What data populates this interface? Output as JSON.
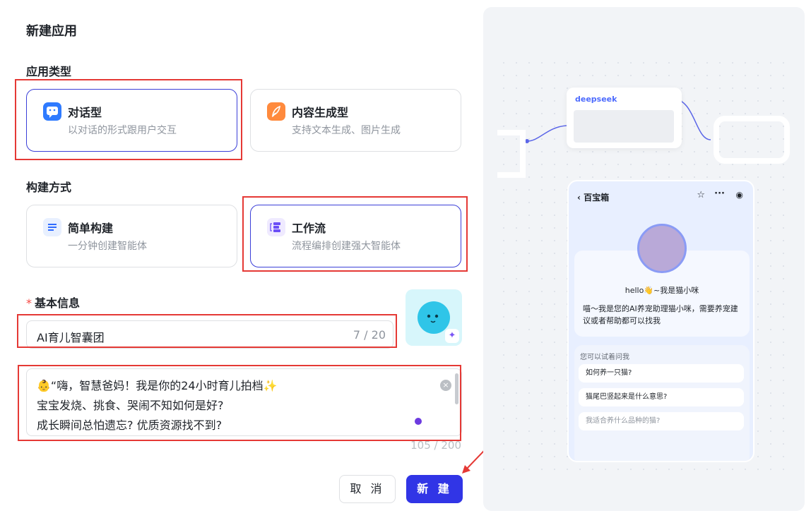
{
  "dialog": {
    "title": "新建应用"
  },
  "app_type": {
    "label": "应用类型",
    "options": [
      {
        "title": "对话型",
        "desc": "以对话的形式跟用户交互",
        "icon": "chat-icon",
        "selected": true
      },
      {
        "title": "内容生成型",
        "desc": "支持文本生成、图片生成",
        "icon": "feather-icon",
        "selected": false
      }
    ]
  },
  "build_mode": {
    "label": "构建方式",
    "options": [
      {
        "title": "简单构建",
        "desc": "一分钟创建智能体",
        "icon": "list-icon",
        "selected": false
      },
      {
        "title": "工作流",
        "desc": "流程编排创建强大智能体",
        "icon": "workflow-icon",
        "selected": true
      }
    ]
  },
  "basic_info": {
    "required_mark": "*",
    "label": "基本信息",
    "name_value": "AI育儿智囊团",
    "name_count": "7 / 20",
    "description_lines": [
      "“嗨，智慧爸妈！我是你的24小时育儿拍档",
      "宝宝发烧、挑食、哭闹不知如何是好?",
      "成长瞬间总怕遗忘? 优质资源找不到?"
    ],
    "description_count": "105 / 200"
  },
  "buttons": {
    "cancel": "取 消",
    "create": "新 建"
  },
  "preview": {
    "node_brand": "deepseek",
    "phone_title": "百宝箱",
    "hello": "hello👋~我是猫小咪",
    "intro": "喵～我是您的AI养宠助理猫小咪，需要养宠建议或者帮助都可以找我",
    "question_label": "您可以试着问我",
    "questions": [
      "如何养一只猫?",
      "猫尾巴竖起来是什么意思?",
      "我适合养什么品种的猫?"
    ]
  },
  "colors": {
    "primary": "#3135e6",
    "highlight_box": "#e53935",
    "selected_border": "#3b3fd8"
  }
}
